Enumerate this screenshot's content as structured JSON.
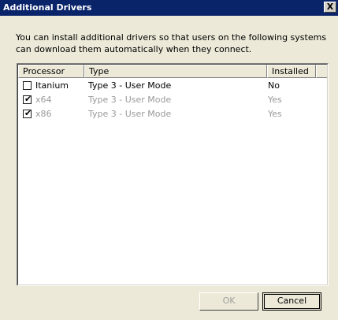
{
  "dialog": {
    "title": "Additional Drivers",
    "close_glyph": "X",
    "description": "You can install additional drivers so that users on the following systems can download them automatically when they connect."
  },
  "table": {
    "columns": [
      "Processor",
      "Type",
      "Installed"
    ],
    "rows": [
      {
        "processor": "Itanium",
        "type": "Type 3 - User Mode",
        "installed": "No",
        "checked": false,
        "disabled": false
      },
      {
        "processor": "x64",
        "type": "Type 3 - User Mode",
        "installed": "Yes",
        "checked": true,
        "disabled": true
      },
      {
        "processor": "x86",
        "type": "Type 3 - User Mode",
        "installed": "Yes",
        "checked": true,
        "disabled": true
      }
    ]
  },
  "buttons": {
    "ok": "OK",
    "cancel": "Cancel"
  },
  "icons": {
    "close": "close-icon",
    "checkmark": "checkmark-icon"
  }
}
